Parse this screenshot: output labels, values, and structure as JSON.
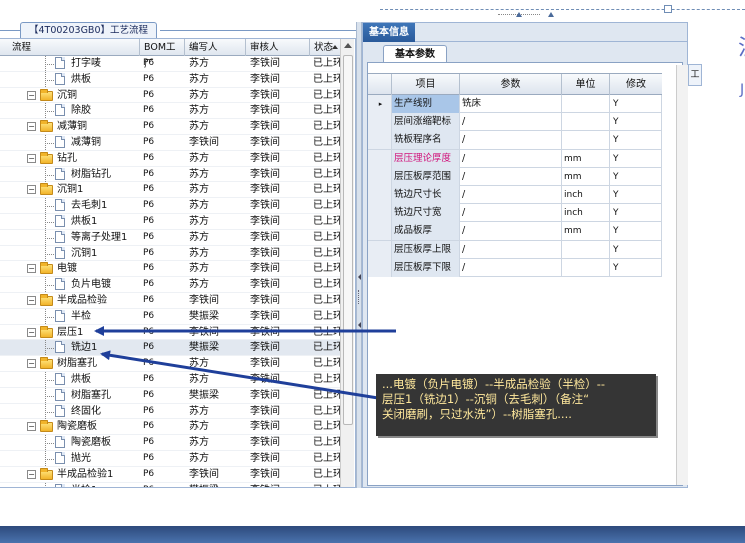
{
  "window": {
    "left_tab_title": "【4T00203GB0】工艺流程",
    "right_tab_title": "基本信息",
    "right_subtab_title": "基本参数",
    "right_strip_label": "工",
    "right_strip_glyph": "注",
    "right_strip_glyph2": "J"
  },
  "left_grid": {
    "columns": [
      "流程",
      "BOM工厂",
      "编写人",
      "审核人",
      "状态"
    ],
    "rows": [
      {
        "label": "打字唛",
        "level": 1,
        "type": "doc",
        "bom": "P6",
        "writer": "苏方",
        "reviewer": "李铁间",
        "status": "已上环"
      },
      {
        "label": "烘板",
        "level": 1,
        "type": "doc",
        "bom": "P6",
        "writer": "苏方",
        "reviewer": "李铁间",
        "status": "已上环"
      },
      {
        "label": "沉铜",
        "level": 0,
        "type": "folder",
        "bom": "P6",
        "writer": "苏方",
        "reviewer": "李铁间",
        "status": "已上环"
      },
      {
        "label": "除胶",
        "level": 1,
        "type": "doc",
        "bom": "P6",
        "writer": "苏方",
        "reviewer": "李铁间",
        "status": "已上环"
      },
      {
        "label": "减薄铜",
        "level": 0,
        "type": "folder",
        "bom": "P6",
        "writer": "苏方",
        "reviewer": "李铁间",
        "status": "已上环"
      },
      {
        "label": "减薄铜",
        "level": 1,
        "type": "doc",
        "bom": "P6",
        "writer": "李铁间",
        "reviewer": "李铁间",
        "status": "已上环"
      },
      {
        "label": "钻孔",
        "level": 0,
        "type": "folder",
        "bom": "P6",
        "writer": "苏方",
        "reviewer": "李铁间",
        "status": "已上环"
      },
      {
        "label": "树脂钻孔",
        "level": 1,
        "type": "doc",
        "bom": "P6",
        "writer": "苏方",
        "reviewer": "李铁间",
        "status": "已上环"
      },
      {
        "label": "沉铜1",
        "level": 0,
        "type": "folder",
        "bom": "P6",
        "writer": "苏方",
        "reviewer": "李铁间",
        "status": "已上环"
      },
      {
        "label": "去毛刺1",
        "level": 1,
        "type": "doc",
        "bom": "P6",
        "writer": "苏方",
        "reviewer": "李铁间",
        "status": "已上环"
      },
      {
        "label": "烘板1",
        "level": 1,
        "type": "doc",
        "bom": "P6",
        "writer": "苏方",
        "reviewer": "李铁间",
        "status": "已上环"
      },
      {
        "label": "等离子处理1",
        "level": 1,
        "type": "doc",
        "bom": "P6",
        "writer": "苏方",
        "reviewer": "李铁间",
        "status": "已上环"
      },
      {
        "label": "沉铜1",
        "level": 1,
        "type": "doc",
        "bom": "P6",
        "writer": "苏方",
        "reviewer": "李铁间",
        "status": "已上环"
      },
      {
        "label": "电镀",
        "level": 0,
        "type": "folder",
        "bom": "P6",
        "writer": "苏方",
        "reviewer": "李铁间",
        "status": "已上环"
      },
      {
        "label": "负片电镀",
        "level": 1,
        "type": "doc",
        "bom": "P6",
        "writer": "苏方",
        "reviewer": "李铁间",
        "status": "已上环"
      },
      {
        "label": "半成品检验",
        "level": 0,
        "type": "folder",
        "bom": "P6",
        "writer": "李铁间",
        "reviewer": "李铁间",
        "status": "已上环"
      },
      {
        "label": "半检",
        "level": 1,
        "type": "doc",
        "bom": "P6",
        "writer": "樊振梁",
        "reviewer": "李铁间",
        "status": "已上环"
      },
      {
        "label": "层压1",
        "level": 0,
        "type": "folder",
        "bom": "P6",
        "writer": "李铁间",
        "reviewer": "李铁间",
        "status": "已上环"
      },
      {
        "label": "铣边1",
        "level": 1,
        "type": "doc",
        "bom": "P6",
        "writer": "樊振梁",
        "reviewer": "李铁间",
        "status": "已上环"
      },
      {
        "label": "树脂塞孔",
        "level": 0,
        "type": "folder",
        "bom": "P6",
        "writer": "苏方",
        "reviewer": "李铁间",
        "status": "已上环"
      },
      {
        "label": "烘板",
        "level": 1,
        "type": "doc",
        "bom": "P6",
        "writer": "苏方",
        "reviewer": "李铁间",
        "status": "已上环"
      },
      {
        "label": "树脂塞孔",
        "level": 1,
        "type": "doc",
        "bom": "P6",
        "writer": "樊振梁",
        "reviewer": "李铁间",
        "status": "已上环"
      },
      {
        "label": "终固化",
        "level": 1,
        "type": "doc",
        "bom": "P6",
        "writer": "苏方",
        "reviewer": "李铁间",
        "status": "已上环"
      },
      {
        "label": "陶瓷磨板",
        "level": 0,
        "type": "folder",
        "bom": "P6",
        "writer": "苏方",
        "reviewer": "李铁间",
        "status": "已上环"
      },
      {
        "label": "陶瓷磨板",
        "level": 1,
        "type": "doc",
        "bom": "P6",
        "writer": "苏方",
        "reviewer": "李铁间",
        "status": "已上环"
      },
      {
        "label": "抛光",
        "level": 1,
        "type": "doc",
        "bom": "P6",
        "writer": "苏方",
        "reviewer": "李铁间",
        "status": "已上环"
      },
      {
        "label": "半成品检验1",
        "level": 0,
        "type": "folder",
        "bom": "P6",
        "writer": "李铁间",
        "reviewer": "李铁间",
        "status": "已上环"
      },
      {
        "label": "半检1",
        "level": 1,
        "type": "doc",
        "bom": "P6",
        "writer": "樊振梁",
        "reviewer": "李铁间",
        "status": "已上环"
      }
    ]
  },
  "param_grid": {
    "columns": [
      "项目",
      "参数",
      "单位",
      "修改"
    ],
    "rows": [
      {
        "item": "生产线别",
        "value": "铣床",
        "unit": "",
        "edit": "Y",
        "current": true,
        "highlight": "selected"
      },
      {
        "item": "层间涨缩靶标",
        "value": "/",
        "unit": "",
        "edit": "Y",
        "current": false,
        "highlight": ""
      },
      {
        "item": "铣板程序名",
        "value": "/",
        "unit": "",
        "edit": "Y",
        "current": false,
        "highlight": ""
      },
      {
        "item": "层压理论厚度",
        "value": "/",
        "unit": "mm",
        "edit": "Y",
        "current": false,
        "highlight": "pink"
      },
      {
        "item": "层压板厚范围",
        "value": "/",
        "unit": "mm",
        "edit": "Y",
        "current": false,
        "highlight": ""
      },
      {
        "item": "铣边尺寸长",
        "value": "/",
        "unit": "inch",
        "edit": "Y",
        "current": false,
        "highlight": ""
      },
      {
        "item": "铣边尺寸宽",
        "value": "/",
        "unit": "inch",
        "edit": "Y",
        "current": false,
        "highlight": ""
      },
      {
        "item": "成品板厚",
        "value": "/",
        "unit": "mm",
        "edit": "Y",
        "current": false,
        "highlight": ""
      },
      {
        "item": "层压板厚上限",
        "value": "/",
        "unit": "",
        "edit": "Y",
        "current": false,
        "highlight": ""
      },
      {
        "item": "层压板厚下限",
        "value": "/",
        "unit": "",
        "edit": "Y",
        "current": false,
        "highlight": ""
      }
    ],
    "current_row_marker": "▸"
  },
  "callout": {
    "lines": [
      "...电镀（负片电镀）--半成品检验（半检）--",
      "层压1（铣边1）--沉铜（去毛刺）（备注“",
      "关闭磨刷，只过水洗”）--树脂塞孔...."
    ]
  },
  "colors": {
    "arrow": "#1f3f9a",
    "callout_text": "#ffe89c",
    "header_blue": "#2a5a9a",
    "pink_label": "#d0127a"
  }
}
